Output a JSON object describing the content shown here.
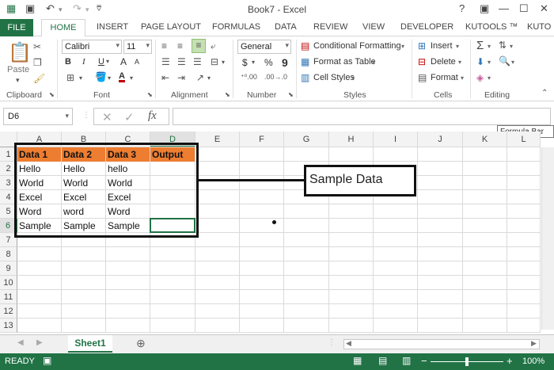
{
  "title": "Book7 - Excel",
  "qat": {
    "save_icon": "save-icon",
    "undo_icon": "undo-icon",
    "redo_icon": "redo-icon"
  },
  "window": {
    "help": "?",
    "restore_ribbon": "▣",
    "minimize": "—",
    "maximize": "☐",
    "close": "✕"
  },
  "tabs": [
    "FILE",
    "HOME",
    "INSERT",
    "PAGE LAYOUT",
    "FORMULAS",
    "DATA",
    "REVIEW",
    "VIEW",
    "DEVELOPER",
    "KUTOOLS ™",
    "KUTO"
  ],
  "ribbon": {
    "clipboard": {
      "paste": "Paste",
      "label": "Clipboard"
    },
    "font": {
      "name": "Calibri",
      "size": "11",
      "bold": "B",
      "italic": "I",
      "underline": "U",
      "grow": "A",
      "shrink": "A",
      "color_letter": "A",
      "label": "Font"
    },
    "alignment": {
      "label": "Alignment"
    },
    "number": {
      "format": "General",
      "currency": "$",
      "percent": "%",
      "comma": "9",
      "label": "Number"
    },
    "styles": {
      "conditional": "Conditional Formatting",
      "table": "Format as Table",
      "cell_styles": "Cell Styles",
      "label": "Styles"
    },
    "cells": {
      "insert": "Insert",
      "delete": "Delete",
      "format": "Format",
      "label": "Cells"
    },
    "editing": {
      "label": "Editing"
    }
  },
  "formula_bar": {
    "name_box": "D6",
    "cancel": "✕",
    "enter": "✓",
    "fx": "fx",
    "value": "",
    "tooltip": "Formula Bar"
  },
  "columns": [
    "A",
    "B",
    "C",
    "D",
    "E",
    "F",
    "G",
    "H",
    "I",
    "J",
    "K",
    "L"
  ],
  "rows": [
    "1",
    "2",
    "3",
    "4",
    "5",
    "6",
    "7",
    "8",
    "9",
    "10",
    "11",
    "12",
    "13"
  ],
  "cells": {
    "A1": "Data 1",
    "B1": "Data 2",
    "C1": "Data 3",
    "D1": "Output",
    "A2": "Hello",
    "B2": "Hello",
    "C2": "hello",
    "A3": "World",
    "B3": "World",
    "C3": "World",
    "A4": "Excel",
    "B4": "Excel",
    "C4": "Excel",
    "A5": "Word",
    "B5": "word",
    "C5": "Word",
    "A6": "Sample",
    "B6": "Sample",
    "C6": "Sample"
  },
  "callout": "Sample Data",
  "sheets": {
    "active": "Sheet1",
    "add": "⊕"
  },
  "status": {
    "ready": "READY",
    "zoom": "100%",
    "zoom_minus": "−",
    "zoom_plus": "+"
  },
  "colors": {
    "accent": "#217346",
    "header_fill": "#ed7d31"
  }
}
